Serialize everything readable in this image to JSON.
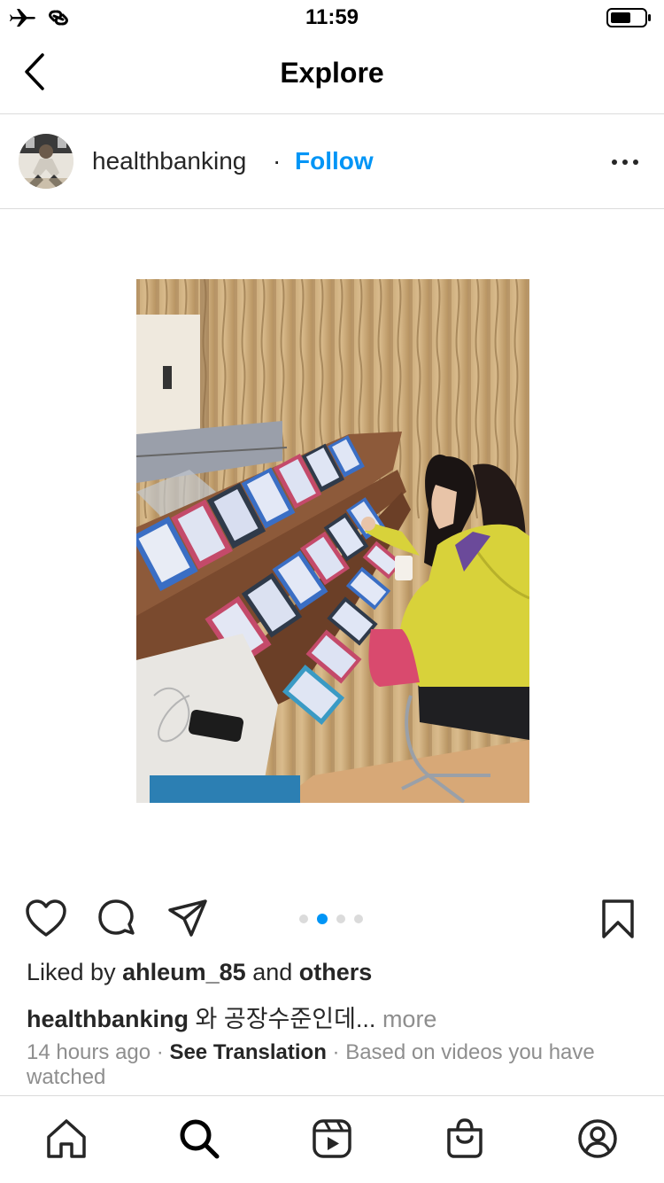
{
  "status_bar": {
    "time": "11:59",
    "icons": [
      "airplane-icon",
      "link-icon",
      "battery-icon"
    ]
  },
  "nav": {
    "back_icon": "chevron-left-icon",
    "title": "Explore"
  },
  "post": {
    "username": "healthbanking",
    "separator": "·",
    "follow_label": "Follow",
    "more_icon": "more-horizontal-icon",
    "carousel": {
      "count": 4,
      "active_index": 1
    }
  },
  "actions": {
    "icons": [
      "heart-icon",
      "comment-icon",
      "share-icon",
      "bookmark-icon"
    ]
  },
  "likes": {
    "prefix": "Liked by",
    "user": "ahleum_85",
    "conjunction": "and",
    "others": "others"
  },
  "caption": {
    "username": "healthbanking",
    "text": "와 공장수준인데...",
    "more": "more"
  },
  "meta": {
    "time_ago": "14 hours ago",
    "separator": "·",
    "see_translation": "See Translation",
    "based_on": "Based on videos you have watched"
  },
  "tab_bar": {
    "tabs": [
      "home-icon",
      "search-icon",
      "reels-icon",
      "shop-icon",
      "profile-icon"
    ]
  },
  "colors": {
    "accent": "#0095f6",
    "text": "#262626",
    "muted": "#8e8e8e",
    "divider": "#dbdbdb"
  }
}
